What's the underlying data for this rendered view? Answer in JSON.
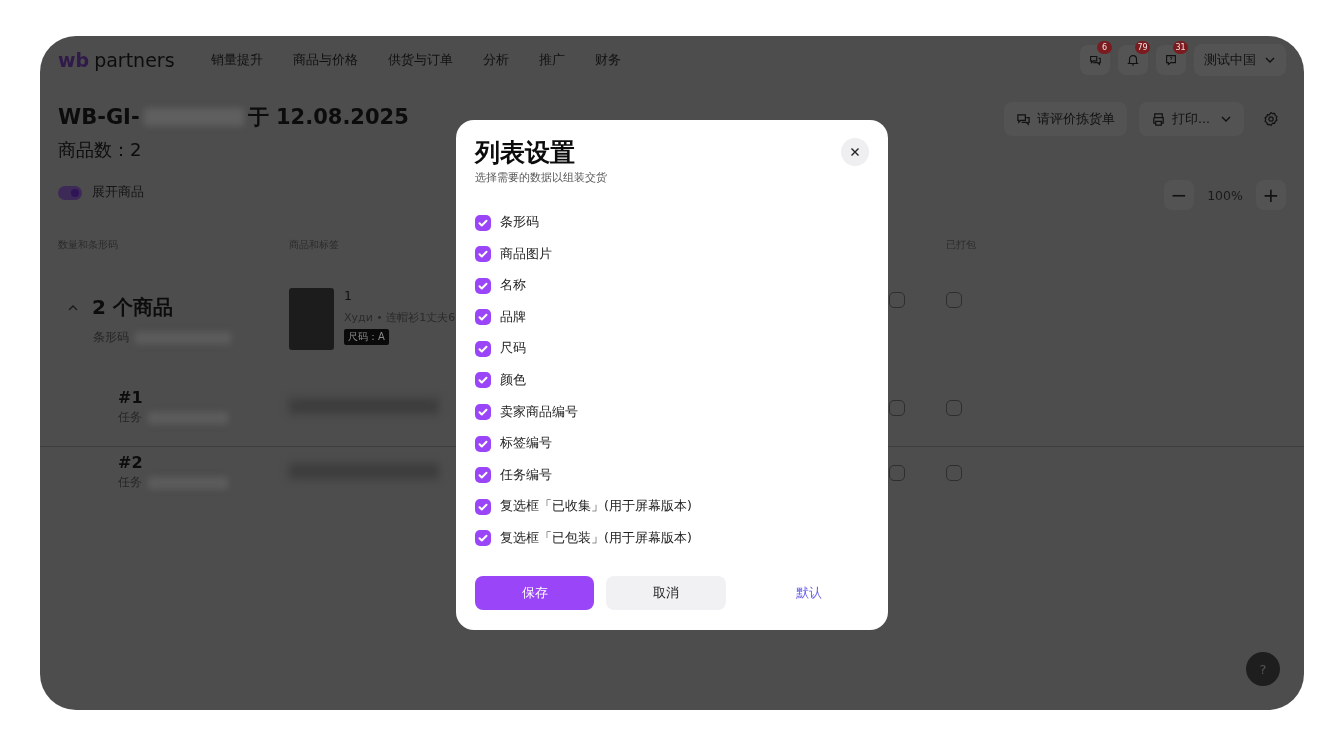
{
  "nav": {
    "logo_mark": "wb",
    "logo_text": "partners",
    "items": [
      "销量提升",
      "商品与价格",
      "供货与订单",
      "分析",
      "推广",
      "财务"
    ],
    "badges": [
      {
        "kind": "chat",
        "count": "6"
      },
      {
        "kind": "bell",
        "count": "79"
      },
      {
        "kind": "support",
        "count": "31"
      }
    ],
    "account": "测试中国"
  },
  "header": {
    "title_prefix": "WB-GI-",
    "title_suffix": "于 12.08.2025",
    "count": "商品数：2",
    "actions": [
      {
        "kind": "review",
        "label": "请评价拣货单"
      },
      {
        "kind": "print",
        "label": "打印..."
      }
    ],
    "toggle": {
      "label": "展开商品",
      "on": true
    },
    "zoom": {
      "minus": "−",
      "value": "100%",
      "plus": "+"
    }
  },
  "table": {
    "columns": [
      "数量和条形码",
      "商品和标签",
      "已打包"
    ],
    "group": {
      "title": "2 个商品",
      "barcode_label": "条形码",
      "expanded": true,
      "quantity": "1",
      "product_name": "Худи • 连帽衫1丈夫6",
      "size_tag": "尺码：A",
      "collected": false,
      "packed": false
    },
    "rows": [
      {
        "number": "#1",
        "task_label": "任务",
        "collected": false,
        "packed": false
      },
      {
        "number": "#2",
        "task_label": "任务",
        "collected": false,
        "packed": false
      }
    ]
  },
  "dialog": {
    "title": "列表设置",
    "subtitle": "选择需要的数据以组装交货",
    "options": [
      {
        "label": "条形码",
        "checked": true
      },
      {
        "label": "商品图片",
        "checked": true
      },
      {
        "label": "名称",
        "checked": true
      },
      {
        "label": "品牌",
        "checked": true
      },
      {
        "label": "尺码",
        "checked": true
      },
      {
        "label": "颜色",
        "checked": true
      },
      {
        "label": "卖家商品编号",
        "checked": true
      },
      {
        "label": "标签编号",
        "checked": true
      },
      {
        "label": "任务编号",
        "checked": true
      },
      {
        "label": "复选框「已收集」(用于屏幕版本)",
        "checked": true
      },
      {
        "label": "复选框「已包装」(用于屏幕版本)",
        "checked": true
      }
    ],
    "buttons": [
      {
        "kind": "primary",
        "label": "保存"
      },
      {
        "kind": "secondary",
        "label": "取消"
      },
      {
        "kind": "link",
        "label": "默认"
      }
    ]
  },
  "help": "?"
}
